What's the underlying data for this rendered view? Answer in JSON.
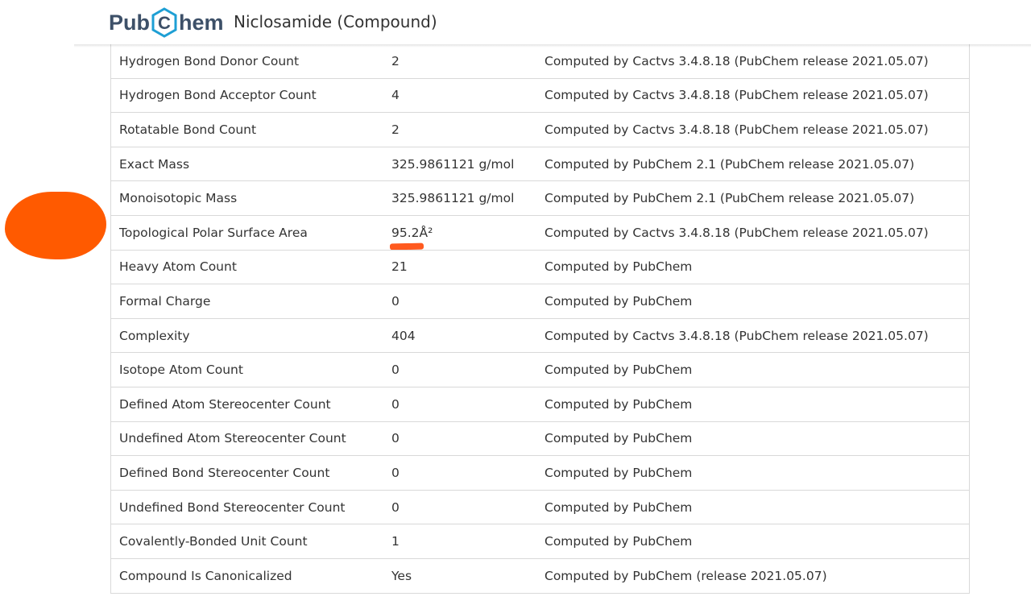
{
  "header": {
    "logo_left": "Pub",
    "logo_hex_letter": "C",
    "logo_right": "hem",
    "title": "Niclosamide (Compound)",
    "brand_color": "#3d5068",
    "hex_color": "#1e9fd4"
  },
  "properties": [
    {
      "name": "Hydrogen Bond Donor Count",
      "value": "2",
      "reference": "Computed by Cactvs 3.4.8.18 (PubChem release 2021.05.07)"
    },
    {
      "name": "Hydrogen Bond Acceptor Count",
      "value": "4",
      "reference": "Computed by Cactvs 3.4.8.18 (PubChem release 2021.05.07)"
    },
    {
      "name": "Rotatable Bond Count",
      "value": "2",
      "reference": "Computed by Cactvs 3.4.8.18 (PubChem release 2021.05.07)"
    },
    {
      "name": "Exact Mass",
      "value": "325.9861121 g/mol",
      "reference": "Computed by PubChem 2.1 (PubChem release 2021.05.07)"
    },
    {
      "name": "Monoisotopic Mass",
      "value": "325.9861121 g/mol",
      "reference": "Computed by PubChem 2.1 (PubChem release 2021.05.07)"
    },
    {
      "name": "Topological Polar Surface Area",
      "value": "95.2Å²",
      "reference": "Computed by Cactvs 3.4.8.18 (PubChem release 2021.05.07)"
    },
    {
      "name": "Heavy Atom Count",
      "value": "21",
      "reference": "Computed by PubChem"
    },
    {
      "name": "Formal Charge",
      "value": "0",
      "reference": "Computed by PubChem"
    },
    {
      "name": "Complexity",
      "value": "404",
      "reference": "Computed by Cactvs 3.4.8.18 (PubChem release 2021.05.07)"
    },
    {
      "name": "Isotope Atom Count",
      "value": "0",
      "reference": "Computed by PubChem"
    },
    {
      "name": "Defined Atom Stereocenter Count",
      "value": "0",
      "reference": "Computed by PubChem"
    },
    {
      "name": "Undefined Atom Stereocenter Count",
      "value": "0",
      "reference": "Computed by PubChem"
    },
    {
      "name": "Defined Bond Stereocenter Count",
      "value": "0",
      "reference": "Computed by PubChem"
    },
    {
      "name": "Undefined Bond Stereocenter Count",
      "value": "0",
      "reference": "Computed by PubChem"
    },
    {
      "name": "Covalently-Bonded Unit Count",
      "value": "1",
      "reference": "Computed by PubChem"
    },
    {
      "name": "Compound Is Canonicalized",
      "value": "Yes",
      "reference": "Computed by PubChem (release 2021.05.07)"
    }
  ],
  "annotations": {
    "highlight_color": "#ff5a1f",
    "highlighted_row": 5
  }
}
